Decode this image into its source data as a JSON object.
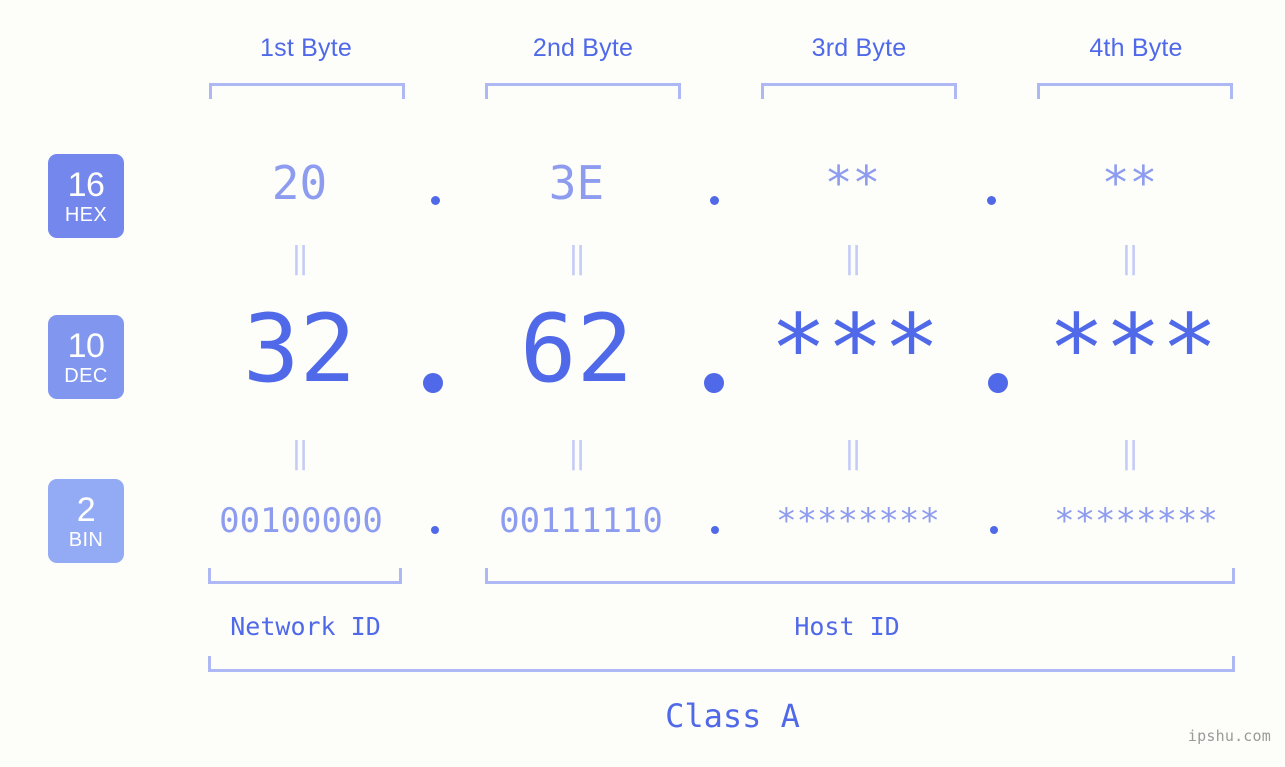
{
  "headers": [
    {
      "label": "1st Byte"
    },
    {
      "label": "2nd Byte"
    },
    {
      "label": "3rd Byte"
    },
    {
      "label": "4th Byte"
    }
  ],
  "bases": [
    {
      "num": "16",
      "abbr": "HEX",
      "color": "#7487ec"
    },
    {
      "num": "10",
      "abbr": "DEC",
      "color": "#8197ef"
    },
    {
      "num": "2",
      "abbr": "BIN",
      "color": "#93aaf4"
    }
  ],
  "rows": {
    "hex": {
      "base_num": "16",
      "base_abbr": "HEX",
      "values": [
        "20",
        "3E",
        "**",
        "**"
      ]
    },
    "dec": {
      "base_num": "10",
      "base_abbr": "DEC",
      "values": [
        "32",
        "62",
        "***",
        "***"
      ]
    },
    "bin": {
      "base_num": "2",
      "base_abbr": "BIN",
      "values": [
        "00100000",
        "00111110",
        "********",
        "********"
      ]
    }
  },
  "equals_glyph": "‖",
  "separator": ".",
  "segments": [
    {
      "label": "Network ID"
    },
    {
      "label": "Host ID"
    }
  ],
  "class_label": "Class A",
  "watermark": "ipshu.com",
  "colors": {
    "background": "#fdfefa",
    "accent_strong": "#5069e8",
    "accent_mid": "#8e9cf0",
    "accent_light": "#aeb8f4",
    "connector": "#c3cbf7",
    "watermark": "#9a9a9a"
  }
}
